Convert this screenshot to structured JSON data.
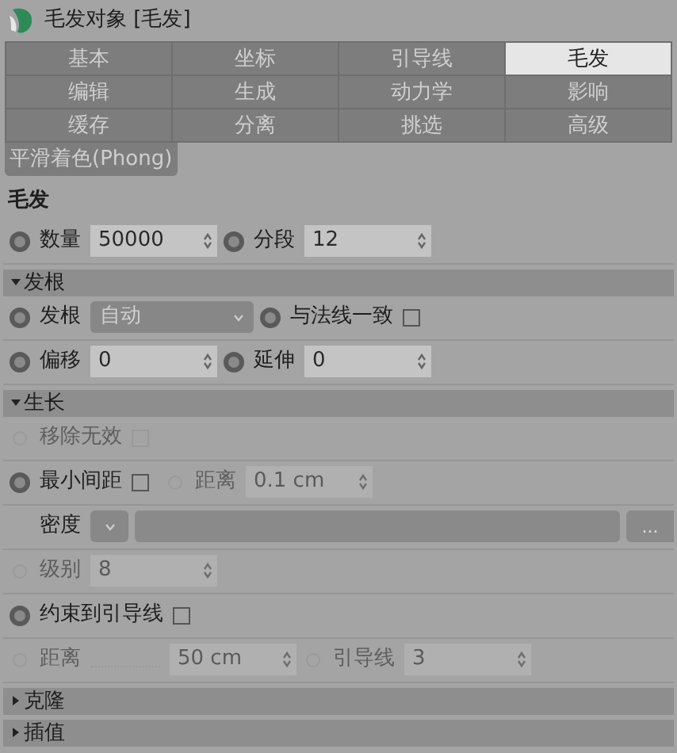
{
  "window": {
    "title": "毛发对象 [毛发]"
  },
  "tabs": [
    {
      "label": "基本",
      "selected": false
    },
    {
      "label": "坐标",
      "selected": false
    },
    {
      "label": "引导线",
      "selected": false
    },
    {
      "label": "毛发",
      "selected": true
    },
    {
      "label": "编辑",
      "selected": false
    },
    {
      "label": "生成",
      "selected": false
    },
    {
      "label": "动力学",
      "selected": false
    },
    {
      "label": "影响",
      "selected": false
    },
    {
      "label": "缓存",
      "selected": false
    },
    {
      "label": "分离",
      "selected": false
    },
    {
      "label": "挑选",
      "selected": false
    },
    {
      "label": "高级",
      "selected": false
    }
  ],
  "extra_tabs": [
    {
      "label": "平滑着色(Phong)",
      "selected": false
    }
  ],
  "sections": [
    {
      "kind": "heading",
      "title": "毛发",
      "rows": [
        [
          {
            "kind": "spinner",
            "label": "数量",
            "value": "50000",
            "disabled": false
          },
          {
            "kind": "spinner",
            "label": "分段",
            "value": "12",
            "disabled": false
          }
        ]
      ]
    },
    {
      "kind": "group",
      "title": "发根",
      "expanded": true,
      "rows": [
        [
          {
            "kind": "dropdown",
            "label": "发根",
            "value": "自动",
            "disabled": false
          },
          {
            "kind": "checkbox",
            "label": "与法线一致",
            "checked": false,
            "disabled": false
          }
        ],
        [
          {
            "kind": "spinner",
            "label": "偏移",
            "value": "0",
            "disabled": false
          },
          {
            "kind": "spinner",
            "label": "延伸",
            "value": "0",
            "disabled": false
          }
        ]
      ]
    },
    {
      "kind": "group",
      "title": "生长",
      "expanded": true,
      "rows": [
        [
          {
            "kind": "checkbox",
            "label": "移除无效",
            "checked": false,
            "disabled": true
          }
        ],
        [
          {
            "kind": "checkbox",
            "label": "最小间距",
            "checked": false,
            "disabled": false
          },
          {
            "kind": "spinner",
            "label": "距离",
            "value": "0.1 cm",
            "disabled": true
          }
        ],
        [
          {
            "kind": "shader",
            "label": "密度",
            "button": "..."
          }
        ],
        [
          {
            "kind": "spinner",
            "label": "级别",
            "value": "8",
            "disabled": true
          }
        ],
        [
          {
            "kind": "checkbox",
            "label": "约束到引导线",
            "checked": false,
            "disabled": false
          }
        ],
        [
          {
            "kind": "spinner",
            "label": "距离",
            "value": "50 cm",
            "disabled": true,
            "leader": true
          },
          {
            "kind": "spinner",
            "label": "引导线",
            "value": "3",
            "disabled": true
          }
        ]
      ]
    },
    {
      "kind": "group",
      "title": "克隆",
      "expanded": false
    },
    {
      "kind": "group",
      "title": "插值",
      "expanded": false
    }
  ]
}
